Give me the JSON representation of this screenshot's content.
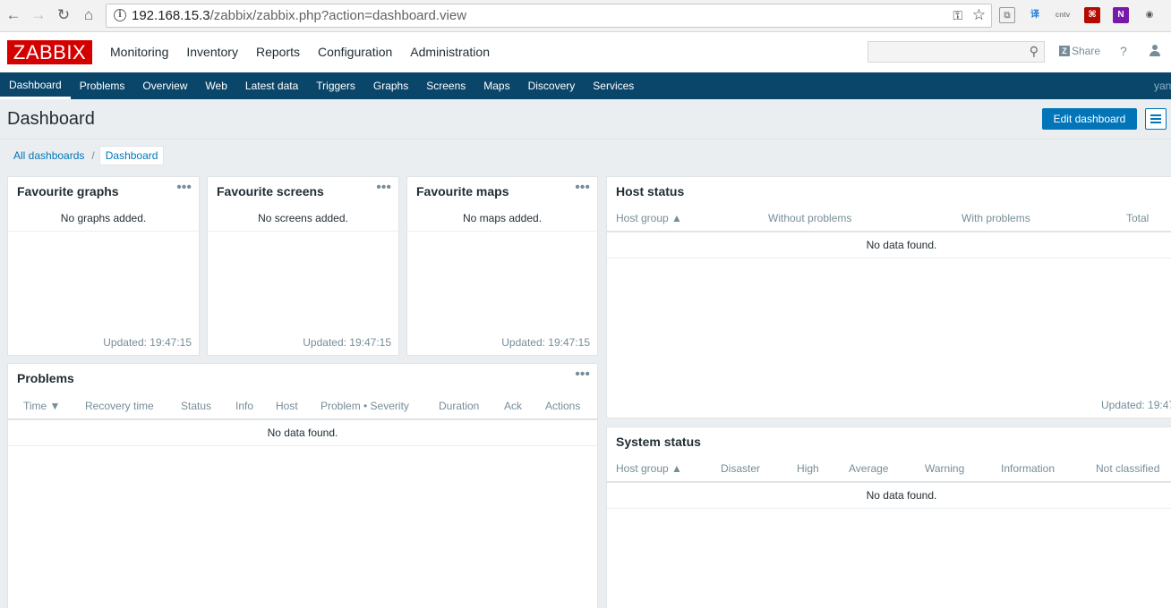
{
  "browser": {
    "url_host": "192.168.15.3",
    "url_path": "/zabbix/zabbix.php?action=dashboard.view"
  },
  "header": {
    "logo": "ZABBIX",
    "menu": [
      "Monitoring",
      "Inventory",
      "Reports",
      "Configuration",
      "Administration"
    ],
    "share_label": "Share",
    "help_label": "?"
  },
  "subnav": {
    "items": [
      "Dashboard",
      "Problems",
      "Overview",
      "Web",
      "Latest data",
      "Triggers",
      "Graphs",
      "Screens",
      "Maps",
      "Discovery",
      "Services"
    ],
    "active": "Dashboard",
    "user": "yan"
  },
  "page": {
    "title": "Dashboard",
    "edit_button": "Edit dashboard"
  },
  "breadcrumb": {
    "parent": "All dashboards",
    "separator": "/",
    "current": "Dashboard"
  },
  "widgets": {
    "fav_graphs": {
      "title": "Favourite graphs",
      "message": "No graphs added.",
      "updated": "Updated: 19:47:15"
    },
    "fav_screens": {
      "title": "Favourite screens",
      "message": "No screens added.",
      "updated": "Updated: 19:47:15"
    },
    "fav_maps": {
      "title": "Favourite maps",
      "message": "No maps added.",
      "updated": "Updated: 19:47:15"
    },
    "host_status": {
      "title": "Host status",
      "columns": [
        "Host group ▲",
        "Without problems",
        "With problems",
        "Total"
      ],
      "empty": "No data found.",
      "updated": "Updated: 19:47"
    },
    "problems": {
      "title": "Problems",
      "columns": [
        "Time ▼",
        "Recovery time",
        "Status",
        "Info",
        "Host",
        "Problem • Severity",
        "Duration",
        "Ack",
        "Actions"
      ],
      "empty": "No data found."
    },
    "system_status": {
      "title": "System status",
      "columns": [
        "Host group ▲",
        "Disaster",
        "High",
        "Average",
        "Warning",
        "Information",
        "Not classified"
      ],
      "empty": "No data found."
    }
  },
  "menu_dots": "•••"
}
